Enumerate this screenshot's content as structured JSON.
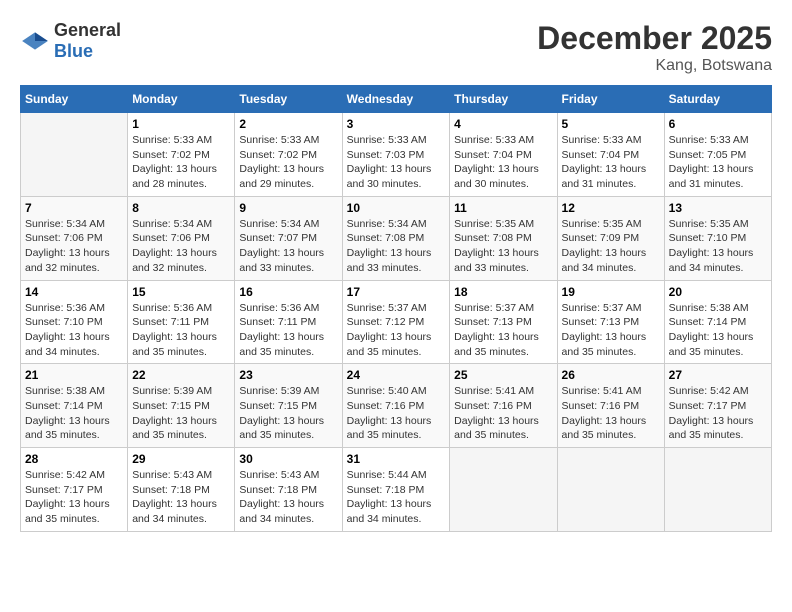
{
  "header": {
    "logo_general": "General",
    "logo_blue": "Blue",
    "title": "December 2025",
    "subtitle": "Kang, Botswana"
  },
  "calendar": {
    "days_of_week": [
      "Sunday",
      "Monday",
      "Tuesday",
      "Wednesday",
      "Thursday",
      "Friday",
      "Saturday"
    ],
    "weeks": [
      [
        {
          "day": "",
          "sunrise": "",
          "sunset": "",
          "daylight": ""
        },
        {
          "day": "1",
          "sunrise": "Sunrise: 5:33 AM",
          "sunset": "Sunset: 7:02 PM",
          "daylight": "Daylight: 13 hours and 28 minutes."
        },
        {
          "day": "2",
          "sunrise": "Sunrise: 5:33 AM",
          "sunset": "Sunset: 7:02 PM",
          "daylight": "Daylight: 13 hours and 29 minutes."
        },
        {
          "day": "3",
          "sunrise": "Sunrise: 5:33 AM",
          "sunset": "Sunset: 7:03 PM",
          "daylight": "Daylight: 13 hours and 30 minutes."
        },
        {
          "day": "4",
          "sunrise": "Sunrise: 5:33 AM",
          "sunset": "Sunset: 7:04 PM",
          "daylight": "Daylight: 13 hours and 30 minutes."
        },
        {
          "day": "5",
          "sunrise": "Sunrise: 5:33 AM",
          "sunset": "Sunset: 7:04 PM",
          "daylight": "Daylight: 13 hours and 31 minutes."
        },
        {
          "day": "6",
          "sunrise": "Sunrise: 5:33 AM",
          "sunset": "Sunset: 7:05 PM",
          "daylight": "Daylight: 13 hours and 31 minutes."
        }
      ],
      [
        {
          "day": "7",
          "sunrise": "Sunrise: 5:34 AM",
          "sunset": "Sunset: 7:06 PM",
          "daylight": "Daylight: 13 hours and 32 minutes."
        },
        {
          "day": "8",
          "sunrise": "Sunrise: 5:34 AM",
          "sunset": "Sunset: 7:06 PM",
          "daylight": "Daylight: 13 hours and 32 minutes."
        },
        {
          "day": "9",
          "sunrise": "Sunrise: 5:34 AM",
          "sunset": "Sunset: 7:07 PM",
          "daylight": "Daylight: 13 hours and 33 minutes."
        },
        {
          "day": "10",
          "sunrise": "Sunrise: 5:34 AM",
          "sunset": "Sunset: 7:08 PM",
          "daylight": "Daylight: 13 hours and 33 minutes."
        },
        {
          "day": "11",
          "sunrise": "Sunrise: 5:35 AM",
          "sunset": "Sunset: 7:08 PM",
          "daylight": "Daylight: 13 hours and 33 minutes."
        },
        {
          "day": "12",
          "sunrise": "Sunrise: 5:35 AM",
          "sunset": "Sunset: 7:09 PM",
          "daylight": "Daylight: 13 hours and 34 minutes."
        },
        {
          "day": "13",
          "sunrise": "Sunrise: 5:35 AM",
          "sunset": "Sunset: 7:10 PM",
          "daylight": "Daylight: 13 hours and 34 minutes."
        }
      ],
      [
        {
          "day": "14",
          "sunrise": "Sunrise: 5:36 AM",
          "sunset": "Sunset: 7:10 PM",
          "daylight": "Daylight: 13 hours and 34 minutes."
        },
        {
          "day": "15",
          "sunrise": "Sunrise: 5:36 AM",
          "sunset": "Sunset: 7:11 PM",
          "daylight": "Daylight: 13 hours and 35 minutes."
        },
        {
          "day": "16",
          "sunrise": "Sunrise: 5:36 AM",
          "sunset": "Sunset: 7:11 PM",
          "daylight": "Daylight: 13 hours and 35 minutes."
        },
        {
          "day": "17",
          "sunrise": "Sunrise: 5:37 AM",
          "sunset": "Sunset: 7:12 PM",
          "daylight": "Daylight: 13 hours and 35 minutes."
        },
        {
          "day": "18",
          "sunrise": "Sunrise: 5:37 AM",
          "sunset": "Sunset: 7:13 PM",
          "daylight": "Daylight: 13 hours and 35 minutes."
        },
        {
          "day": "19",
          "sunrise": "Sunrise: 5:37 AM",
          "sunset": "Sunset: 7:13 PM",
          "daylight": "Daylight: 13 hours and 35 minutes."
        },
        {
          "day": "20",
          "sunrise": "Sunrise: 5:38 AM",
          "sunset": "Sunset: 7:14 PM",
          "daylight": "Daylight: 13 hours and 35 minutes."
        }
      ],
      [
        {
          "day": "21",
          "sunrise": "Sunrise: 5:38 AM",
          "sunset": "Sunset: 7:14 PM",
          "daylight": "Daylight: 13 hours and 35 minutes."
        },
        {
          "day": "22",
          "sunrise": "Sunrise: 5:39 AM",
          "sunset": "Sunset: 7:15 PM",
          "daylight": "Daylight: 13 hours and 35 minutes."
        },
        {
          "day": "23",
          "sunrise": "Sunrise: 5:39 AM",
          "sunset": "Sunset: 7:15 PM",
          "daylight": "Daylight: 13 hours and 35 minutes."
        },
        {
          "day": "24",
          "sunrise": "Sunrise: 5:40 AM",
          "sunset": "Sunset: 7:16 PM",
          "daylight": "Daylight: 13 hours and 35 minutes."
        },
        {
          "day": "25",
          "sunrise": "Sunrise: 5:41 AM",
          "sunset": "Sunset: 7:16 PM",
          "daylight": "Daylight: 13 hours and 35 minutes."
        },
        {
          "day": "26",
          "sunrise": "Sunrise: 5:41 AM",
          "sunset": "Sunset: 7:16 PM",
          "daylight": "Daylight: 13 hours and 35 minutes."
        },
        {
          "day": "27",
          "sunrise": "Sunrise: 5:42 AM",
          "sunset": "Sunset: 7:17 PM",
          "daylight": "Daylight: 13 hours and 35 minutes."
        }
      ],
      [
        {
          "day": "28",
          "sunrise": "Sunrise: 5:42 AM",
          "sunset": "Sunset: 7:17 PM",
          "daylight": "Daylight: 13 hours and 35 minutes."
        },
        {
          "day": "29",
          "sunrise": "Sunrise: 5:43 AM",
          "sunset": "Sunset: 7:18 PM",
          "daylight": "Daylight: 13 hours and 34 minutes."
        },
        {
          "day": "30",
          "sunrise": "Sunrise: 5:43 AM",
          "sunset": "Sunset: 7:18 PM",
          "daylight": "Daylight: 13 hours and 34 minutes."
        },
        {
          "day": "31",
          "sunrise": "Sunrise: 5:44 AM",
          "sunset": "Sunset: 7:18 PM",
          "daylight": "Daylight: 13 hours and 34 minutes."
        },
        {
          "day": "",
          "sunrise": "",
          "sunset": "",
          "daylight": ""
        },
        {
          "day": "",
          "sunrise": "",
          "sunset": "",
          "daylight": ""
        },
        {
          "day": "",
          "sunrise": "",
          "sunset": "",
          "daylight": ""
        }
      ]
    ]
  }
}
